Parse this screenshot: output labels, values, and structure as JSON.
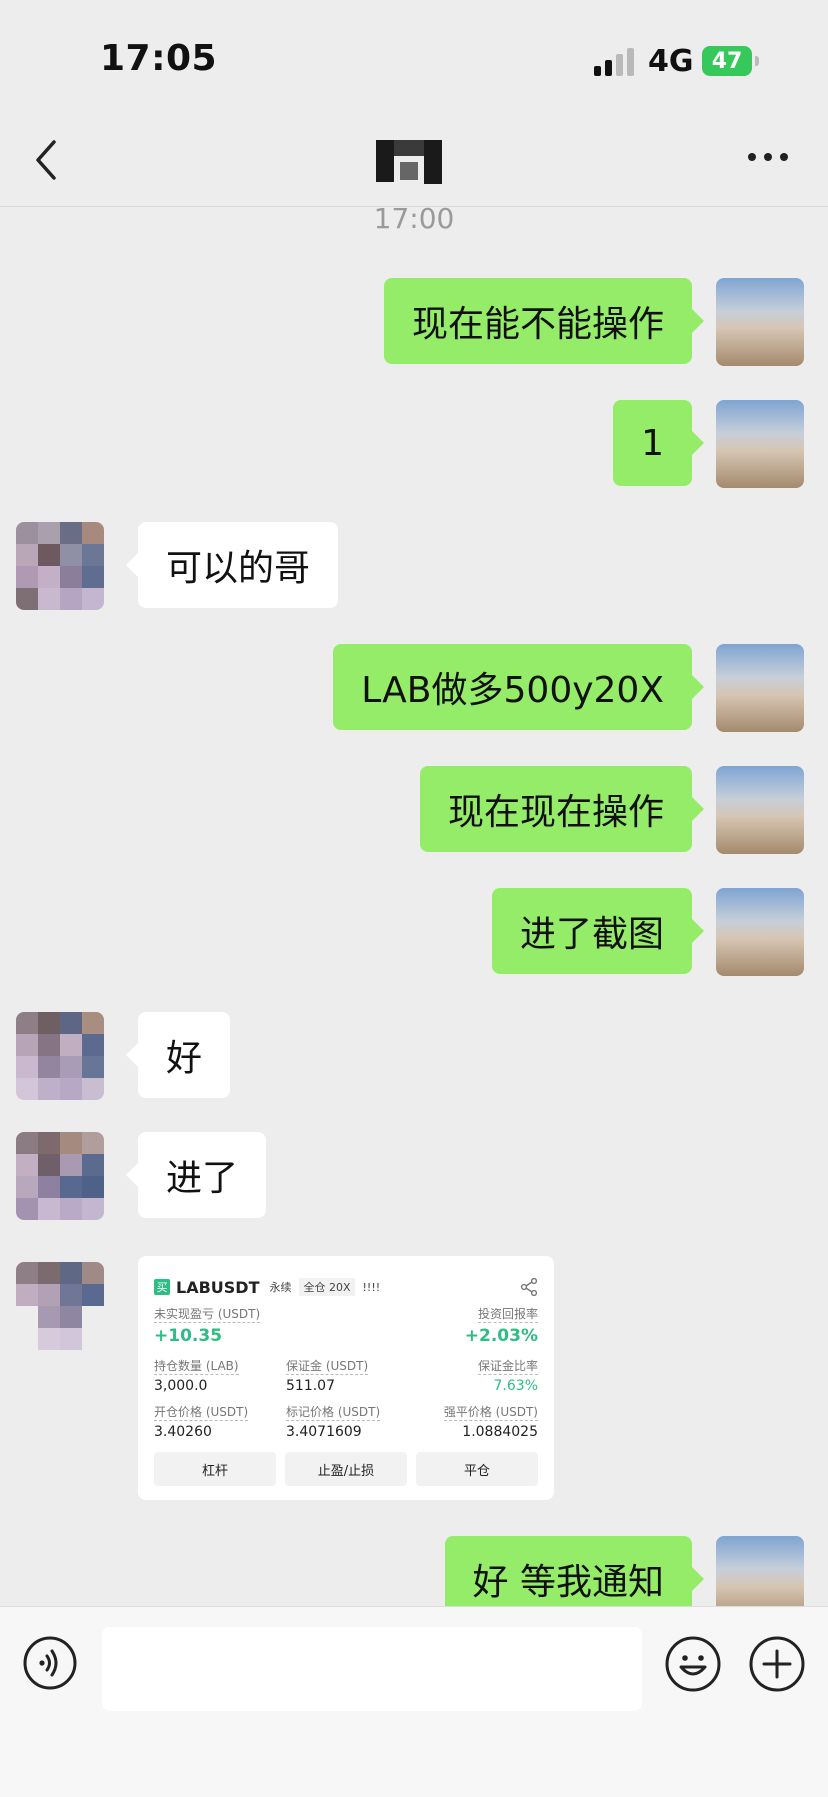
{
  "status": {
    "time": "17:05",
    "network": "4G",
    "battery": "47"
  },
  "nav": {
    "more": "···"
  },
  "time_separator": "17:00",
  "messages": [
    {
      "side": "self",
      "text": "现在能不能操作"
    },
    {
      "side": "self",
      "text": "1"
    },
    {
      "side": "other",
      "text": "可以的哥"
    },
    {
      "side": "self",
      "text": "LAB做多500y20X"
    },
    {
      "side": "self",
      "text": "现在现在操作"
    },
    {
      "side": "self",
      "text": "进了截图"
    },
    {
      "side": "other",
      "text": "好"
    },
    {
      "side": "other",
      "text": "进了"
    },
    {
      "side": "self",
      "text": "好 等我通知"
    }
  ],
  "card": {
    "side_tag": "买",
    "symbol": "LABUSDT",
    "type": "永续",
    "margin_mode": "全仓 20X",
    "bars": "!!!!",
    "unrealized_pnl_label": "未实现盈亏 (USDT)",
    "unrealized_pnl_value": "+10.35",
    "roi_label": "投资回报率",
    "roi_value": "+2.03%",
    "position_label": "持仓数量 (LAB)",
    "position_value": "3,000.0",
    "margin_label": "保证金 (USDT)",
    "margin_value": "511.07",
    "margin_ratio_label": "保证金比率",
    "margin_ratio_value": "7.63%",
    "entry_price_label": "开仓价格 (USDT)",
    "entry_price_value": "3.40260",
    "mark_price_label": "标记价格 (USDT)",
    "mark_price_value": "3.4071609",
    "liq_price_label": "强平价格 (USDT)",
    "liq_price_value": "1.0884025",
    "btn_leverage": "杠杆",
    "btn_tpsl": "止盈/止损",
    "btn_close": "平仓"
  },
  "colors": {
    "self_bubble": "#95ec69",
    "other_bubble": "#ffffff",
    "background": "#ededed",
    "profit_green": "#2ebd85"
  }
}
